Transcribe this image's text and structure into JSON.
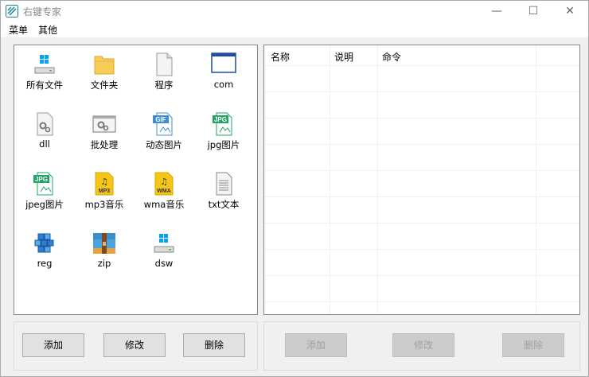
{
  "window": {
    "title": "右键专家"
  },
  "menu": {
    "items": [
      "菜单",
      "其他"
    ]
  },
  "icons": [
    {
      "label": "所有文件",
      "icon": "drive-windows-icon"
    },
    {
      "label": "文件夹",
      "icon": "folder-icon"
    },
    {
      "label": "程序",
      "icon": "blank-file-icon"
    },
    {
      "label": "com",
      "icon": "window-app-icon"
    },
    {
      "label": "dll",
      "icon": "gear-file-icon"
    },
    {
      "label": "批处理",
      "icon": "batch-gear-icon"
    },
    {
      "label": "动态图片",
      "icon": "gif-file-icon"
    },
    {
      "label": "jpg图片",
      "icon": "jpg-file-icon"
    },
    {
      "label": "jpeg图片",
      "icon": "jpg-file-icon"
    },
    {
      "label": "mp3音乐",
      "icon": "mp3-file-icon"
    },
    {
      "label": "wma音乐",
      "icon": "wma-file-icon"
    },
    {
      "label": "txt文本",
      "icon": "text-file-icon"
    },
    {
      "label": "reg",
      "icon": "registry-icon"
    },
    {
      "label": "zip",
      "icon": "zip-archive-icon"
    },
    {
      "label": "dsw",
      "icon": "drive-windows-icon"
    }
  ],
  "table": {
    "columns": [
      "名称",
      "说明",
      "命令"
    ],
    "rows": []
  },
  "left_buttons": {
    "add": "添加",
    "edit": "修改",
    "delete": "删除"
  },
  "right_buttons": {
    "add": "添加",
    "edit": "修改",
    "delete": "删除"
  },
  "icon_texts": {
    "gif": "GIF",
    "jpg": "JPG",
    "mp3": "MP3",
    "wma": "WMA"
  },
  "colors": {
    "accent": "#0078d7",
    "jpg_green": "#21a366",
    "gif_blue": "#3c8fd6",
    "music_yellow": "#f5c518",
    "folder_yellow": "#f7cd5a"
  }
}
